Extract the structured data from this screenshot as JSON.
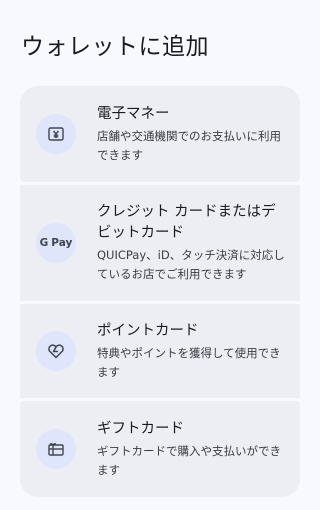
{
  "header": {
    "title": "ウォレットに追加"
  },
  "options": [
    {
      "title": "電子マネー",
      "description": "店舗や交通機関でのお支払いに利用できます",
      "icon": "yen-wallet-icon"
    },
    {
      "title": "クレジット カードまたはデビットカード",
      "description": "QUICPay、iD、タッチ決済に対応しているお店でご利用できます",
      "icon": "gpay-icon",
      "icon_text": "Pay",
      "icon_g": "G"
    },
    {
      "title": "ポイントカード",
      "description": "特典やポイントを獲得して使用できます",
      "icon": "heart-tag-icon"
    },
    {
      "title": "ギフトカード",
      "description": "ギフトカードで購入や支払いができます",
      "icon": "gift-card-icon"
    }
  ],
  "colors": {
    "background": "#f8f9fe",
    "item_bg": "#edeef4",
    "icon_bg": "#dfe5fa",
    "icon_stroke": "#404650"
  }
}
